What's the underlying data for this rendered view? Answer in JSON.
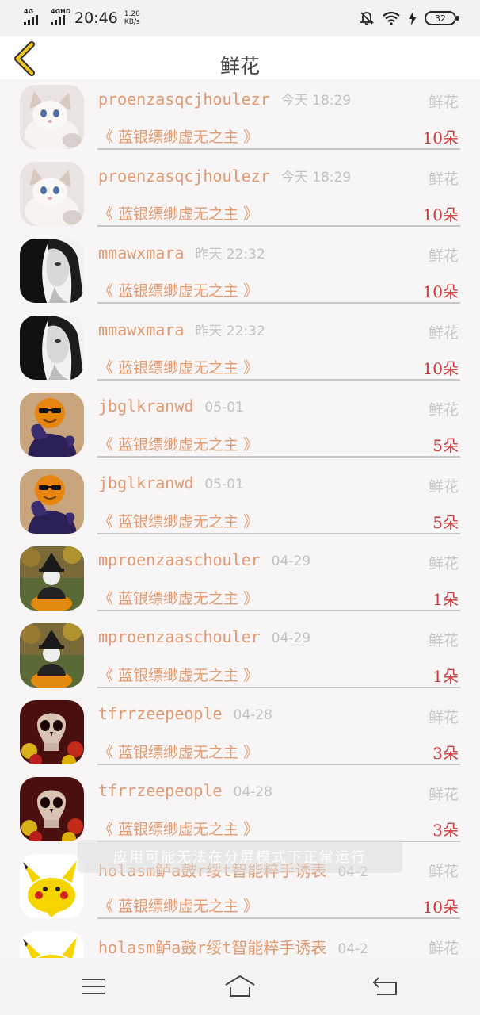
{
  "status_bar": {
    "signal1": "4G",
    "signal2": "4GHD",
    "time": "20:46",
    "net_speed_value": "1.20",
    "net_speed_unit": "KB/s",
    "battery": "32",
    "icons": [
      "mute-bell-icon",
      "wifi-icon",
      "charging-icon",
      "battery-icon"
    ]
  },
  "header": {
    "title": "鲜花",
    "back_icon": "chevron-left-icon"
  },
  "list": {
    "rows": [
      {
        "user": "proenzasqcjhoulezr",
        "time": "今天 18:29",
        "type": "鲜花",
        "book": "《 蓝银缥缈虚无之主 》",
        "count": "10朵",
        "avatar": "cat"
      },
      {
        "user": "proenzasqcjhoulezr",
        "time": "今天 18:29",
        "type": "鲜花",
        "book": "《 蓝银缥缈虚无之主 》",
        "count": "10朵",
        "avatar": "cat"
      },
      {
        "user": "mmawxmara",
        "time": "昨天 22:32",
        "type": "鲜花",
        "book": "《 蓝银缥缈虚无之主 》",
        "count": "10朵",
        "avatar": "woman"
      },
      {
        "user": "mmawxmara",
        "time": "昨天 22:32",
        "type": "鲜花",
        "book": "《 蓝银缥缈虚无之主 》",
        "count": "10朵",
        "avatar": "woman"
      },
      {
        "user": "jbglkranwd",
        "time": "05-01",
        "type": "鲜花",
        "book": "《 蓝银缥缈虚无之主 》",
        "count": "5朵",
        "avatar": "orange"
      },
      {
        "user": "jbglkranwd",
        "time": "05-01",
        "type": "鲜花",
        "book": "《 蓝银缥缈虚无之主 》",
        "count": "5朵",
        "avatar": "orange"
      },
      {
        "user": "mproenzaaschouler",
        "time": "04-29",
        "type": "鲜花",
        "book": "《 蓝银缥缈虚无之主 》",
        "count": "1朵",
        "avatar": "cat-witch"
      },
      {
        "user": "mproenzaaschouler",
        "time": "04-29",
        "type": "鲜花",
        "book": "《 蓝银缥缈虚无之主 》",
        "count": "1朵",
        "avatar": "cat-witch"
      },
      {
        "user": "tfrrzeepeople",
        "time": "04-28",
        "type": "鲜花",
        "book": "《 蓝银缥缈虚无之主 》",
        "count": "3朵",
        "avatar": "skull"
      },
      {
        "user": "tfrrzeepeople",
        "time": "04-28",
        "type": "鲜花",
        "book": "《 蓝银缥缈虚无之主 》",
        "count": "3朵",
        "avatar": "skull"
      },
      {
        "user": "holasm鲈a鼓r绥t智能粹手诱表",
        "time": "04-2",
        "type": "鲜花",
        "book": "《 蓝银缥缈虚无之主 》",
        "count": "10朵",
        "avatar": "pikachu"
      },
      {
        "user": "holasm鲈a鼓r绥t智能粹手诱表",
        "time": "04-2",
        "type": "鲜花",
        "book": "",
        "count": "",
        "avatar": "pikachu"
      }
    ]
  },
  "toast": {
    "text": "应用可能无法在分屏模式下正常运行"
  },
  "nav": {
    "menu_icon": "menu-icon",
    "home_icon": "home-icon",
    "back_icon": "back-arrow-icon"
  }
}
